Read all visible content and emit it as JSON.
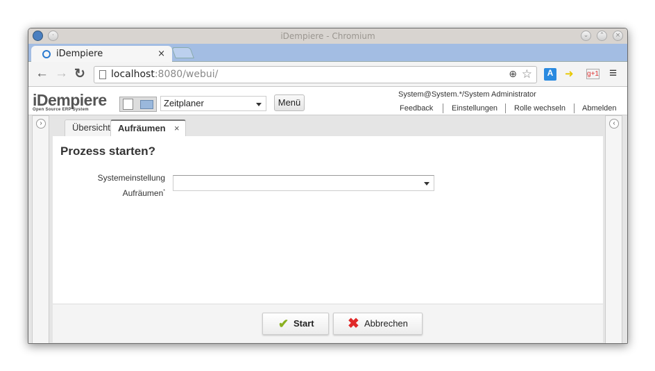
{
  "window": {
    "title": "iDempiere - Chromium"
  },
  "browser": {
    "tab_title": "iDempiere",
    "url_host": "localhost",
    "url_rest": ":8080/webui/"
  },
  "app": {
    "logo": "iDempiere",
    "logo_sub": "Open Source ERP System",
    "menu_select": "Zeitplaner",
    "menu_button": "Menü",
    "user": "System@System.*/System Administrator",
    "links": [
      "Feedback",
      "Einstellungen",
      "Rolle wechseln",
      "Abmelden"
    ]
  },
  "tabs": [
    {
      "label": "Übersicht"
    },
    {
      "label": "Aufräumen"
    }
  ],
  "dialog": {
    "title": "Prozess starten?",
    "field_label_1": "Systemeinstellung",
    "field_label_2": "Aufräumen",
    "required_mark": "*",
    "field_value": "",
    "start": "Start",
    "cancel": "Abbrechen"
  }
}
